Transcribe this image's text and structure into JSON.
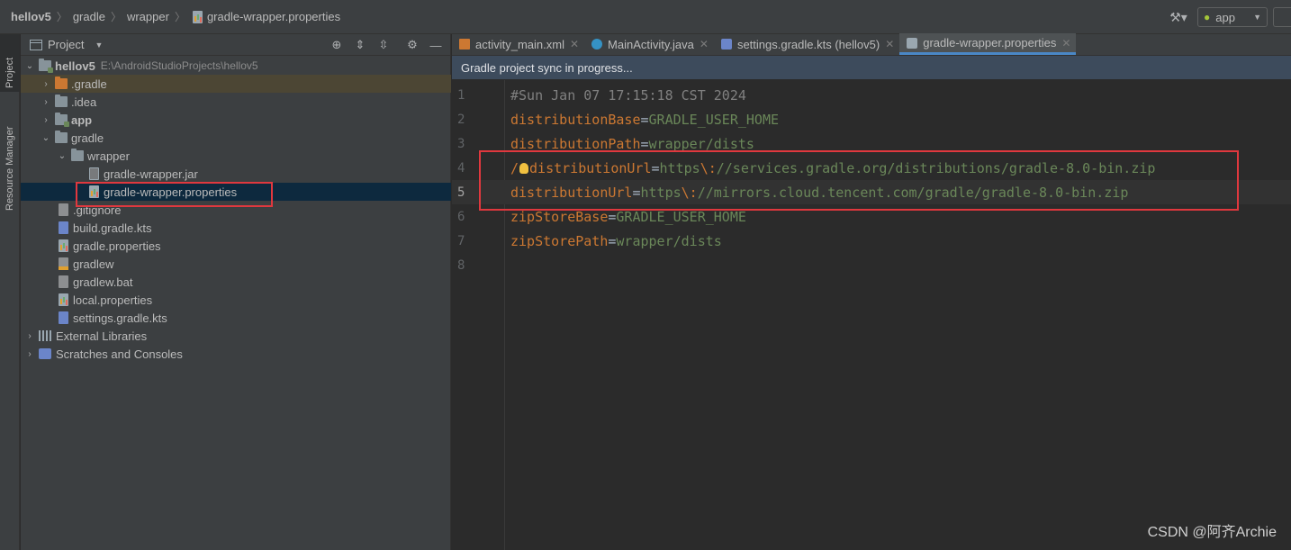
{
  "breadcrumb": {
    "items": [
      "hellov5",
      "gradle",
      "wrapper",
      "gradle-wrapper.properties"
    ]
  },
  "toolbar": {
    "build_icon": "hammer-icon",
    "run_config": "app",
    "run_config_icon": "android-icon"
  },
  "toolstrip": {
    "project_tab": "Project",
    "resource_manager_tab": "Resource Manager"
  },
  "project_panel": {
    "title": "Project",
    "tools": [
      "locate-icon",
      "expand-all-icon",
      "collapse-all-icon",
      "gear-icon",
      "minimize-icon"
    ]
  },
  "tree": [
    {
      "label": "hellov5",
      "path": "E:\\AndroidStudioProjects\\hellov5",
      "icon": "module-folder-icon",
      "expanded": true
    },
    {
      "label": ".gradle",
      "icon": "folder-icon",
      "expanded": false
    },
    {
      "label": ".idea",
      "icon": "folder-icon",
      "expanded": false
    },
    {
      "label": "app",
      "icon": "module-folder-icon",
      "expanded": false
    },
    {
      "label": "gradle",
      "icon": "folder-icon",
      "expanded": true
    },
    {
      "label": "wrapper",
      "icon": "folder-icon",
      "expanded": true
    },
    {
      "label": "gradle-wrapper.jar",
      "icon": "jar-file-icon"
    },
    {
      "label": "gradle-wrapper.properties",
      "icon": "properties-file-icon",
      "selected": true
    },
    {
      "label": ".gitignore",
      "icon": "gitignore-file-icon"
    },
    {
      "label": "build.gradle.kts",
      "icon": "kotlin-script-file-icon"
    },
    {
      "label": "gradle.properties",
      "icon": "properties-file-icon"
    },
    {
      "label": "gradlew",
      "icon": "shell-file-icon"
    },
    {
      "label": "gradlew.bat",
      "icon": "bat-file-icon"
    },
    {
      "label": "local.properties",
      "icon": "properties-file-icon"
    },
    {
      "label": "settings.gradle.kts",
      "icon": "kotlin-script-file-icon"
    },
    {
      "label": "External Libraries",
      "icon": "libraries-icon",
      "expanded": false
    },
    {
      "label": "Scratches and Consoles",
      "icon": "scratches-icon",
      "expanded": false
    }
  ],
  "editor": {
    "tabs": [
      {
        "label": "activity_main.xml",
        "icon": "xml-file-icon"
      },
      {
        "label": "MainActivity.java",
        "icon": "java-class-icon"
      },
      {
        "label": "settings.gradle.kts (hellov5)",
        "icon": "kotlin-script-file-icon"
      },
      {
        "label": "gradle-wrapper.properties",
        "icon": "properties-file-icon",
        "active": true
      }
    ],
    "banner": "Gradle project sync in progress...",
    "current_line": 5,
    "lines": [
      {
        "num": "1",
        "comment": "#Sun Jan 07 17:15:18 CST 2024"
      },
      {
        "num": "2",
        "key": "distributionBase",
        "value": "GRADLE_USER_HOME"
      },
      {
        "num": "3",
        "key": "distributionPath",
        "value": "wrapper/dists"
      },
      {
        "num": "4",
        "prefix": "/",
        "key": "distributionUrl",
        "value_a": "https",
        "value_b": "//services.gradle.org/distributions/gradle-8.0-bin.zip"
      },
      {
        "num": "5",
        "key": "distributionUrl",
        "value_a": "https",
        "value_b": "//mirrors.cloud.tencent.com/gradle/gradle-8.0-bin.zip"
      },
      {
        "num": "6",
        "key": "zipStoreBase",
        "value": "GRADLE_USER_HOME"
      },
      {
        "num": "7",
        "key": "zipStorePath",
        "value": "wrapper/dists"
      },
      {
        "num": "8"
      }
    ]
  },
  "watermark": "CSDN @阿齐Archie",
  "colors": {
    "highlight_box": "#e0383e",
    "selection": "#0d293e",
    "key": "#cc7832",
    "value": "#6a8759",
    "banner": "#3d4b5c"
  }
}
